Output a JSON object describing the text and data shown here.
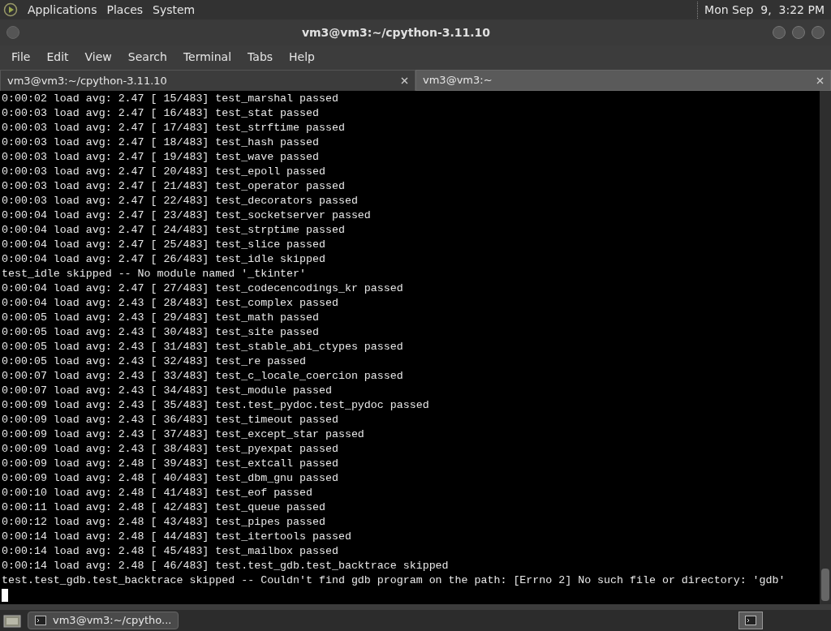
{
  "top_panel": {
    "menus": [
      "Applications",
      "Places",
      "System"
    ],
    "clock": "Mon Sep  9,  3:22 PM"
  },
  "window": {
    "title": "vm3@vm3:~/cpython-3.11.10"
  },
  "menu_bar": [
    "File",
    "Edit",
    "View",
    "Search",
    "Terminal",
    "Tabs",
    "Help"
  ],
  "tabs": [
    {
      "label": "vm3@vm3:~/cpython-3.11.10",
      "selected": true
    },
    {
      "label": "vm3@vm3:~",
      "selected": false
    }
  ],
  "terminal_lines": [
    "0:00:02 load avg: 2.47 [ 15/483] test_marshal passed",
    "0:00:03 load avg: 2.47 [ 16/483] test_stat passed",
    "0:00:03 load avg: 2.47 [ 17/483] test_strftime passed",
    "0:00:03 load avg: 2.47 [ 18/483] test_hash passed",
    "0:00:03 load avg: 2.47 [ 19/483] test_wave passed",
    "0:00:03 load avg: 2.47 [ 20/483] test_epoll passed",
    "0:00:03 load avg: 2.47 [ 21/483] test_operator passed",
    "0:00:03 load avg: 2.47 [ 22/483] test_decorators passed",
    "0:00:04 load avg: 2.47 [ 23/483] test_socketserver passed",
    "0:00:04 load avg: 2.47 [ 24/483] test_strptime passed",
    "0:00:04 load avg: 2.47 [ 25/483] test_slice passed",
    "0:00:04 load avg: 2.47 [ 26/483] test_idle skipped",
    "test_idle skipped -- No module named '_tkinter'",
    "0:00:04 load avg: 2.47 [ 27/483] test_codecencodings_kr passed",
    "0:00:04 load avg: 2.43 [ 28/483] test_complex passed",
    "0:00:05 load avg: 2.43 [ 29/483] test_math passed",
    "0:00:05 load avg: 2.43 [ 30/483] test_site passed",
    "0:00:05 load avg: 2.43 [ 31/483] test_stable_abi_ctypes passed",
    "0:00:05 load avg: 2.43 [ 32/483] test_re passed",
    "0:00:07 load avg: 2.43 [ 33/483] test_c_locale_coercion passed",
    "0:00:07 load avg: 2.43 [ 34/483] test_module passed",
    "0:00:09 load avg: 2.43 [ 35/483] test.test_pydoc.test_pydoc passed",
    "0:00:09 load avg: 2.43 [ 36/483] test_timeout passed",
    "0:00:09 load avg: 2.43 [ 37/483] test_except_star passed",
    "0:00:09 load avg: 2.43 [ 38/483] test_pyexpat passed",
    "0:00:09 load avg: 2.48 [ 39/483] test_extcall passed",
    "0:00:09 load avg: 2.48 [ 40/483] test_dbm_gnu passed",
    "0:00:10 load avg: 2.48 [ 41/483] test_eof passed",
    "0:00:11 load avg: 2.48 [ 42/483] test_queue passed",
    "0:00:12 load avg: 2.48 [ 43/483] test_pipes passed",
    "0:00:14 load avg: 2.48 [ 44/483] test_itertools passed",
    "0:00:14 load avg: 2.48 [ 45/483] test_mailbox passed",
    "0:00:14 load avg: 2.48 [ 46/483] test.test_gdb.test_backtrace skipped",
    "test.test_gdb.test_backtrace skipped -- Couldn't find gdb program on the path: [Errno 2] No such file or directory: 'gdb'"
  ],
  "taskbar": {
    "window_button": "vm3@vm3:~/cpytho..."
  }
}
